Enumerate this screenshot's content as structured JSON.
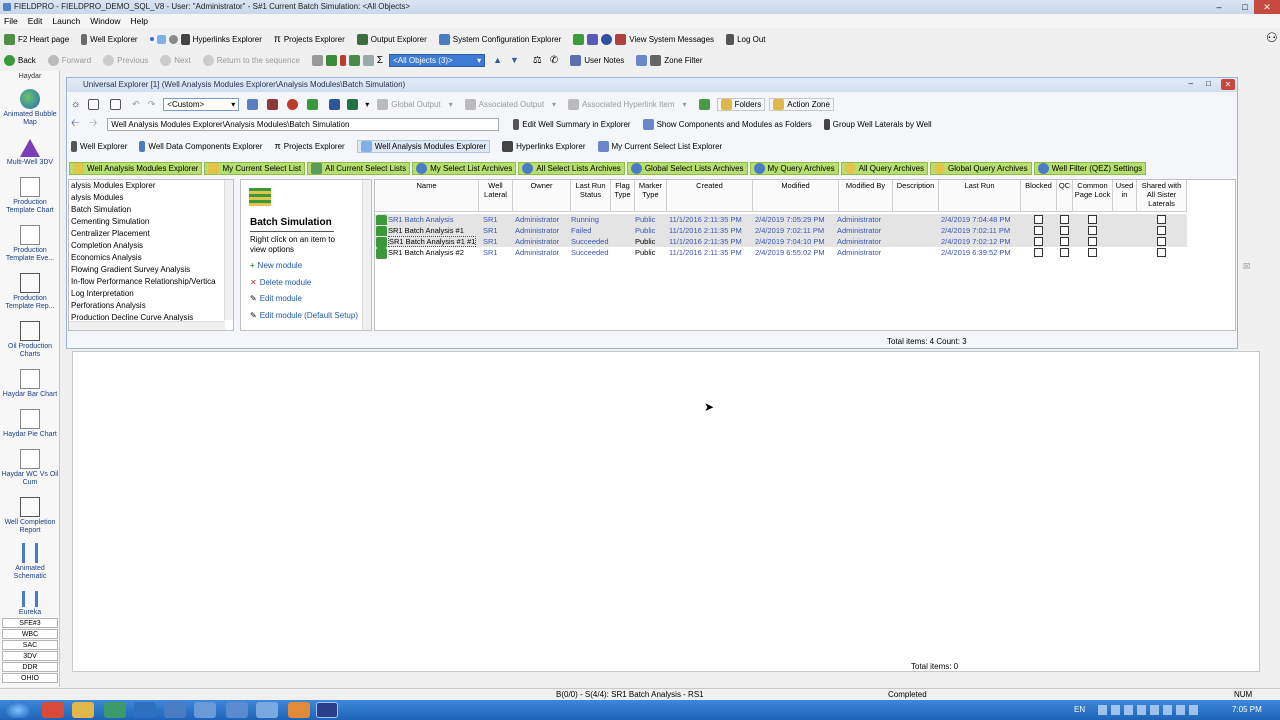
{
  "window": {
    "title": "FIELDPRO - FIELDPRO_DEMO_SQL_V8 - User: \"Administrator\" - S#1 Current Batch Simulation: <All Objects>"
  },
  "menu": [
    "File",
    "Edit",
    "Launch",
    "Window",
    "Help"
  ],
  "toolbar1": {
    "items": [
      "F2 Heart page",
      "Well Explorer",
      "Hyperlinks Explorer",
      "Projects Explorer",
      "Output Explorer",
      "System Configuration Explorer",
      "View System Messages",
      "Log Out"
    ]
  },
  "toolbar2": {
    "back": "Back",
    "forward": "Forward",
    "previous": "Previous",
    "next": "Next",
    "return": "Return to the sequence",
    "all_objects": "<All Objects (3)>",
    "user_notes": "User Notes",
    "zone_filter": "Zone Filter"
  },
  "sidebar": {
    "header": "Haydar",
    "items": [
      {
        "label": "Animated Bubble Map",
        "icon": "globe-icon"
      },
      {
        "label": "Multi-Well 3DV",
        "icon": "pyramid-icon"
      },
      {
        "label": "Production Template Chart",
        "icon": "line-chart-icon"
      },
      {
        "label": "Production Template Eve...",
        "icon": "line-chart-icon"
      },
      {
        "label": "Production Template Rep...",
        "icon": "report-icon"
      },
      {
        "label": "Oil Production Charts",
        "icon": "report-icon"
      },
      {
        "label": "Haydar Bar Chart",
        "icon": "line-chart-icon"
      },
      {
        "label": "Haydar Pie Chart",
        "icon": "line-chart-icon"
      },
      {
        "label": "Haydar WC Vs Oil Cum",
        "icon": "line-chart-icon"
      },
      {
        "label": "Well Completion Report",
        "icon": "report-icon"
      },
      {
        "label": "Animated Schematic",
        "icon": "schematic-icon"
      },
      {
        "label": "Eureka",
        "icon": "schematic-icon"
      }
    ],
    "tabs": [
      "SFE#3",
      "WBC",
      "SAC",
      "3DV",
      "DDR",
      "OHIO"
    ]
  },
  "explorer": {
    "title": "Universal Explorer [1] (Well Analysis Modules Explorer\\Analysis Modules\\Batch Simulation)",
    "view_select": "<Custom>",
    "global_output": "Global Output",
    "associated_output": "Associated Output",
    "associated_hyperlink": "Associated Hyperlink Item",
    "folders": "Folders",
    "action_zone": "Action Zone",
    "path": "Well Analysis Modules Explorer\\Analysis Modules\\Batch Simulation",
    "edit_summary": "Edit Well Summary in Explorer",
    "show_components": "Show Components and Modules as Folders",
    "group_laterals": "Group Well Laterals by Well",
    "tabs": [
      "Well Explorer",
      "Well Data Components Explorer",
      "Projects Explorer",
      "Well Analysis Modules Explorer",
      "Hyperlinks Explorer",
      "My Current Select List Explorer"
    ],
    "green_tabs": [
      "Well Analysis Modules Explorer",
      "My Current Select List",
      "All Current Select Lists",
      "My Select List Archives",
      "All Select Lists Archives",
      "Global Select Lists Archives",
      "My Query Archives",
      "All Query Archives",
      "Global Query Archives",
      "Well Filter (QEZ) Settings"
    ]
  },
  "tree": {
    "nodes": [
      "alysis Modules Explorer",
      "alysis Modules",
      "Batch Simulation",
      "Cementing Simulation",
      "Centralizer Placement",
      "Completion Analysis",
      "Economics Analysis",
      "Flowing Gradient Survey Analysis",
      "In-flow Performance Relationship/Vertica",
      "Log Interpretation",
      "Perforations Analysis",
      "Production Decline Curve Analysis"
    ]
  },
  "actions": {
    "title": "Batch Simulation",
    "hint": "Right click on an item to view options",
    "links": [
      "New module",
      "Delete module",
      "Edit module",
      "Edit module (Default Setup)"
    ]
  },
  "grid": {
    "columns": [
      "Name",
      "Well Lateral",
      "Owner",
      "Last Run Status",
      "Flag Type",
      "Marker Type",
      "Created",
      "Modified",
      "Modified By",
      "Description",
      "Last Run",
      "Blocked",
      "QC",
      "Common Page Lock",
      "Used in",
      "Shared with All Sister Laterals"
    ],
    "rows": [
      {
        "name": "SR1 Batch Analysis",
        "lateral": "SR1",
        "owner": "Administrator",
        "status": "Running",
        "marker": "Public",
        "created": "11/1/2016 2:11:35 PM",
        "modified": "2/4/2019 7:05:29 PM",
        "modified_by": "Administrator",
        "last_run": "2/4/2019 7:04:48 PM"
      },
      {
        "name": "SR1 Batch Analysis #1",
        "lateral": "SR1",
        "owner": "Administrator",
        "status": "Failed",
        "marker": "Public",
        "created": "11/1/2016 2:11:35 PM",
        "modified": "2/4/2019 7:02:11 PM",
        "modified_by": "Administrator",
        "last_run": "2/4/2019 7:02:11 PM"
      },
      {
        "name": "SR1 Batch Analysis #1 #1",
        "lateral": "SR1",
        "owner": "Administrator",
        "status": "Succeeded",
        "marker": "Public",
        "created": "11/1/2016 2:11:35 PM",
        "modified": "2/4/2019 7:04:10 PM",
        "modified_by": "Administrator",
        "last_run": "2/4/2019 7:02:12 PM"
      },
      {
        "name": "SR1 Batch Analysis #2",
        "lateral": "SR1",
        "owner": "Administrator",
        "status": "Succeeded",
        "marker": "Public",
        "created": "11/1/2016 2:11:35 PM",
        "modified": "2/4/2019 6:55:02 PM",
        "modified_by": "Administrator",
        "last_run": "2/4/2019 6:39:52 PM"
      }
    ],
    "footer": "Total items: 4  Count: 3"
  },
  "lower": {
    "footer": "Total items: 0"
  },
  "status": {
    "left": "B(0/0) - S(4/4): SR1 Batch Analysis - RS1",
    "middle": "Completed",
    "right": "NUM"
  },
  "taskbar": {
    "lang": "EN",
    "time": "7:05 PM"
  },
  "colors": {
    "accent": "#3d7bd5",
    "green_tab": "#b7de71",
    "link_blue": "#3a55b8"
  }
}
